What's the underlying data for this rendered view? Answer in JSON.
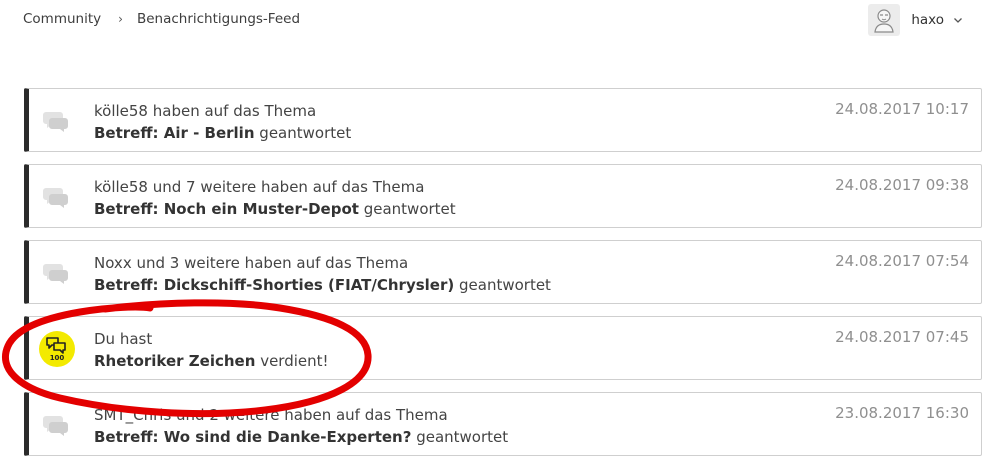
{
  "breadcrumb": {
    "home": "Community",
    "separator": "›",
    "current": "Benachrichtigungs-Feed"
  },
  "user": {
    "name": "haxo"
  },
  "feed": [
    {
      "text": "kölle58 haben auf das Thema",
      "subject": "Betreff: Air - Berlin",
      "suffix": "geantwortet",
      "date": "24.08.2017 10:17",
      "icon": "speech-bubbles-icon"
    },
    {
      "text": "kölle58 und 7 weitere haben auf das Thema",
      "subject": "Betreff: Noch ein Muster-Depot",
      "suffix": "geantwortet",
      "date": "24.08.2017 09:38",
      "icon": "speech-bubbles-icon"
    },
    {
      "text": "Noxx und 3 weitere haben auf das Thema",
      "subject": "Betreff: Dickschiff-Shorties (FIAT/Chrysler)",
      "suffix": "geantwortet",
      "date": "24.08.2017 07:54",
      "icon": "speech-bubbles-icon"
    },
    {
      "text": "Du hast",
      "subject": "Rhetoriker Zeichen",
      "suffix": "verdient!",
      "date": "24.08.2017 07:45",
      "icon": "rank-badge-icon",
      "badge_number": "100",
      "badge_color": "#f3ea00"
    },
    {
      "text": "SMT_Chris und 2 weitere haben auf das Thema",
      "subject": "Betreff: Wo sind die Danke-Experten?",
      "suffix": "geantwortet",
      "date": "23.08.2017 16:30",
      "icon": "speech-bubbles-icon"
    }
  ],
  "colors": {
    "annotation": "#e30000",
    "item_border_left": "#2b2b2b",
    "date": "#8f8f8f"
  }
}
